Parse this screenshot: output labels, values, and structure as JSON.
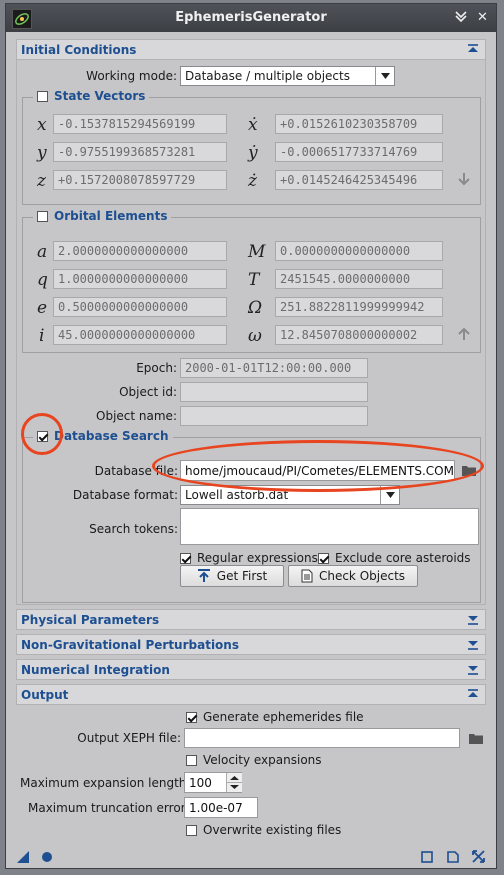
{
  "window": {
    "title": "EphemerisGenerator"
  },
  "titlebar_buttons": [
    "✕"
  ],
  "initial_conditions": {
    "header": "Initial Conditions",
    "working_mode_label": "Working mode:",
    "working_mode_value": "Database / multiple objects",
    "state_vectors": {
      "title": "State Vectors",
      "checked": false,
      "rows": [
        {
          "sym": "x",
          "val": "-0.1537815294569199",
          "dsym": "ẋ",
          "dval": "+0.0152610230358709"
        },
        {
          "sym": "y",
          "val": "-0.9755199368573281",
          "dsym": "ẏ",
          "dval": "-0.0006517733714769"
        },
        {
          "sym": "z",
          "val": "+0.1572008078597729",
          "dsym": "ż",
          "dval": "+0.0145246425345496"
        }
      ]
    },
    "orbital_elements": {
      "title": "Orbital Elements",
      "checked": false,
      "rows": [
        {
          "sym": "a",
          "val": "2.0000000000000000",
          "sym2": "M",
          "val2": "0.0000000000000000"
        },
        {
          "sym": "q",
          "val": "1.0000000000000000",
          "sym2": "T",
          "val2": "2451545.0000000000"
        },
        {
          "sym": "e",
          "val": "0.5000000000000000",
          "sym2": "Ω",
          "val2": "251.8822811999999942"
        },
        {
          "sym": "i",
          "val": "45.0000000000000000",
          "sym2": "ω",
          "val2": "12.8450708000000002"
        }
      ]
    },
    "epoch_label": "Epoch:",
    "epoch_value": "2000-01-01T12:00:00.000",
    "object_id_label": "Object id:",
    "object_name_label": "Object name:",
    "database_search": {
      "title": "Database Search",
      "checked": true,
      "database_file_label": "Database file:",
      "database_file_value": "home/jmoucaud/PI/Cometes/ELEMENTS.COMET",
      "database_format_label": "Database format:",
      "database_format_value": "Lowell astorb.dat",
      "search_tokens_label": "Search tokens:",
      "regular_expressions": "Regular expressions",
      "exclude_core_asteroids": "Exclude core asteroids",
      "get_first": "Get First",
      "check_objects": "Check Objects"
    }
  },
  "sections": {
    "physical": "Physical Parameters",
    "nongrav": "Non-Gravitational Perturbations",
    "numint": "Numerical Integration"
  },
  "output": {
    "header": "Output",
    "generate_ephemerides": "Generate ephemerides file",
    "output_xeph_label": "Output XEPH file:",
    "velocity_expansions": "Velocity expansions",
    "max_expansion_label": "Maximum expansion length:",
    "max_expansion_value": "100",
    "max_truncation_label": "Maximum truncation error:",
    "max_truncation_value": "1.00e-07",
    "overwrite_existing": "Overwrite existing files"
  },
  "colors": {
    "accent": "#1d4f91",
    "annotation": "#e8441f",
    "titlebar": "#45484e"
  }
}
